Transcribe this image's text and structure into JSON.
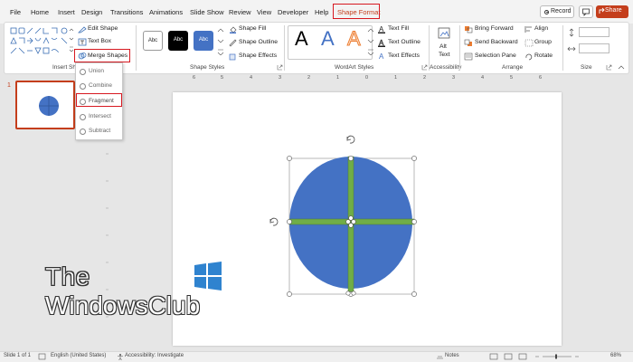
{
  "tabs": [
    {
      "label": "File"
    },
    {
      "label": "Home"
    },
    {
      "label": "Insert"
    },
    {
      "label": "Design"
    },
    {
      "label": "Transitions"
    },
    {
      "label": "Animations"
    },
    {
      "label": "Slide Show"
    },
    {
      "label": "Review"
    },
    {
      "label": "View"
    },
    {
      "label": "Developer"
    },
    {
      "label": "Help"
    },
    {
      "label": "Shape Format"
    }
  ],
  "titlebar": {
    "record": "Record",
    "share": "Share"
  },
  "ribbon": {
    "insert_shapes": {
      "label": "Insert Sha",
      "edit_shape": "Edit Shape",
      "text_box": "Text Box",
      "merge_shapes": "Merge Shapes"
    },
    "shape_styles": {
      "label": "Shape Styles",
      "presets": [
        "Abc",
        "Abc",
        "Abc"
      ],
      "fill": "Shape Fill",
      "outline": "Shape Outline",
      "effects": "Shape Effects"
    },
    "wordart": {
      "label": "WordArt Styles",
      "letters": [
        "A",
        "A",
        "A"
      ],
      "text_fill": "Text Fill",
      "text_outline": "Text Outline",
      "text_effects": "Text Effects"
    },
    "accessibility": {
      "label": "Accessibility",
      "alt_text_1": "Alt",
      "alt_text_2": "Text"
    },
    "arrange": {
      "label": "Arrange",
      "bring_forward": "Bring Forward",
      "send_backward": "Send Backward",
      "selection_pane": "Selection Pane",
      "align": "Align",
      "group": "Group",
      "rotate": "Rotate"
    },
    "size": {
      "label": "Size"
    }
  },
  "merge_menu": {
    "items": [
      "Union",
      "Combine",
      "Fragment",
      "Intersect",
      "Subtract"
    ]
  },
  "slides_pane": {
    "number": "1"
  },
  "ruler": {
    "top": [
      "6",
      "5",
      "4",
      "3",
      "2",
      "1",
      "0",
      "1",
      "2",
      "3",
      "4",
      "5",
      "6"
    ]
  },
  "watermark": {
    "line1": "The",
    "line2": "WindowsClub"
  },
  "status": {
    "slide": "Slide 1 of 1",
    "language": "English (United States)",
    "accessibility": "Accessibility: Investigate",
    "notes": "Notes",
    "zoom": "68%"
  },
  "colors": {
    "accent": "#c43e1c",
    "highlight": "#d71921",
    "shape_fill": "#4472c4",
    "shape_lines": "#70ad47"
  }
}
